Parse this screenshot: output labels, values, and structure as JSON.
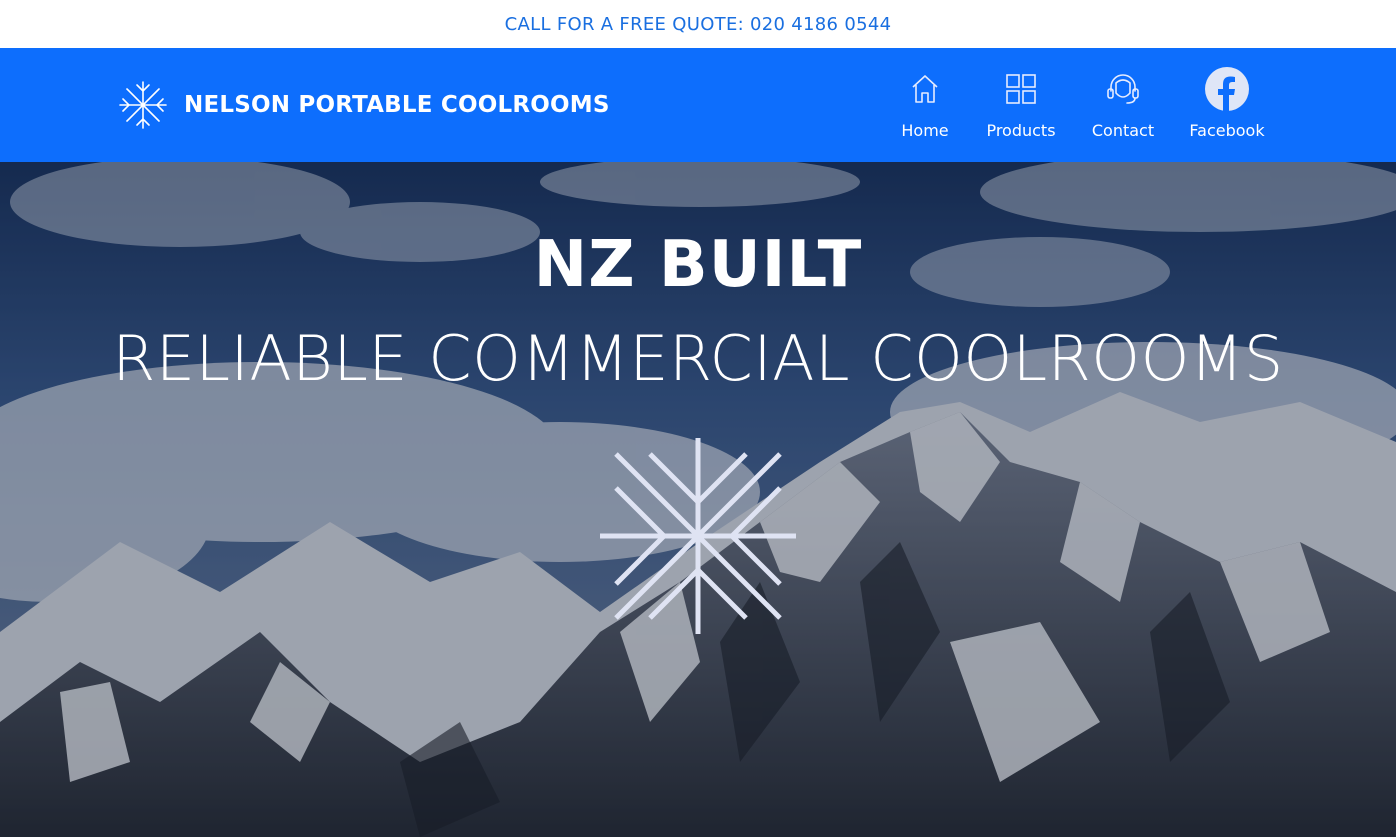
{
  "topbar": {
    "quote_text": "CALL FOR A FREE QUOTE: 020 4186 0544"
  },
  "brand": {
    "name": "NELSON PORTABLE COOLROOMS",
    "icon": "snowflake-icon"
  },
  "nav": {
    "items": [
      {
        "label": "Home",
        "icon": "home-icon"
      },
      {
        "label": "Products",
        "icon": "grid-icon"
      },
      {
        "label": "Contact",
        "icon": "headset-icon"
      },
      {
        "label": "Facebook",
        "icon": "facebook-icon"
      }
    ]
  },
  "hero": {
    "title": "NZ BUILT",
    "subtitle": "RELIABLE COMMERCIAL COOLROOMS",
    "icon": "snowflake-icon",
    "background": "snowy-mountain-photo"
  },
  "colors": {
    "accent": "#0d6efd",
    "topbar_text": "#1a6fe0",
    "snowflake_light": "#dfe3f3"
  }
}
